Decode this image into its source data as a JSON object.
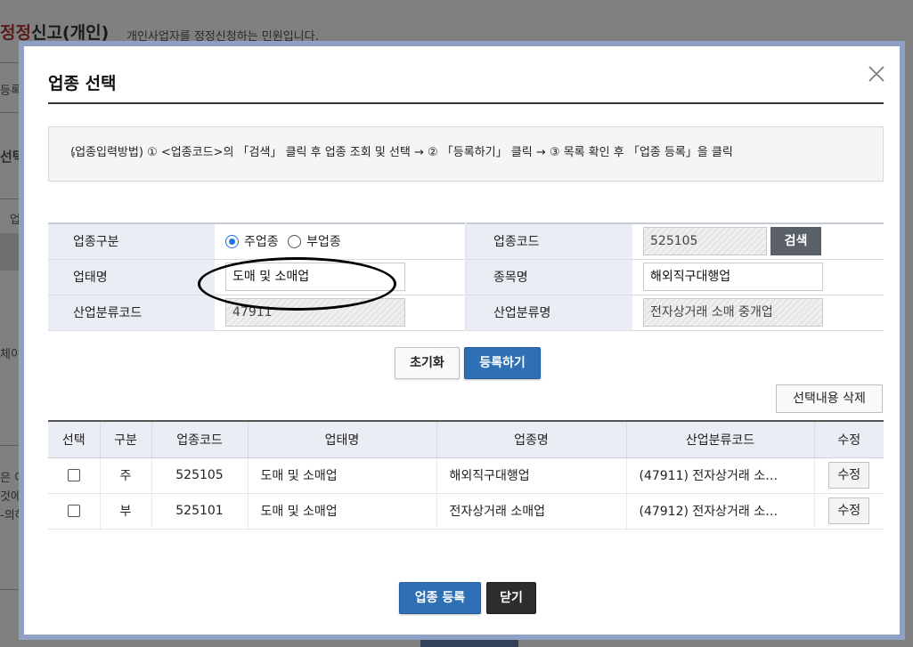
{
  "background": {
    "title_part1": "정정",
    "title_part2": "신고(개인)",
    "subtitle": "개인사업자를 정정신청하는 민원입니다.",
    "frag_reg": "등록",
    "frag_select": "선택",
    "frag_up": "업",
    "frag_che": "체이",
    "frag_line1": "은 이",
    "frag_line2": "것에",
    "frag_line3": "-의하"
  },
  "modal": {
    "title": "업종 선택",
    "notice": "(업종입력방법) ① <업종코드>의 「검색」 클릭 후 업종 조회 및 선택 → ② 「등록하기」 클릭 → ③ 목록 확인 후 「업종 등록」을 클릭",
    "form": {
      "type_label": "업종구분",
      "type_main": "주업종",
      "type_sub": "부업종",
      "code_label": "업종코드",
      "code_value": "525105",
      "search_button": "검색",
      "biz_type_label": "업태명",
      "biz_type_value": "도매 및 소매업",
      "item_label": "종목명",
      "item_value": "해외직구대행업",
      "industry_code_label": "산업분류코드",
      "industry_code_value": "47911",
      "industry_name_label": "산업분류명",
      "industry_name_value": "전자상거래 소매 중개업"
    },
    "reset_button": "초기화",
    "register_button": "등록하기",
    "delete_button": "선택내용 삭제",
    "table": {
      "headers": [
        "선택",
        "구분",
        "업종코드",
        "업태명",
        "업종명",
        "산업분류코드",
        "수정"
      ],
      "rows": [
        {
          "kind": "주",
          "code": "525105",
          "biz": "도매 및 소매업",
          "item": "해외직구대행업",
          "industry": "(47911) 전자상거래 소…",
          "edit": "수정"
        },
        {
          "kind": "부",
          "code": "525101",
          "biz": "도매 및 소매업",
          "item": "전자상거래 소매업",
          "industry": "(47912) 전자상거래 소…",
          "edit": "수정"
        }
      ]
    },
    "submit_button": "업종 등록",
    "close_button": "닫기"
  }
}
